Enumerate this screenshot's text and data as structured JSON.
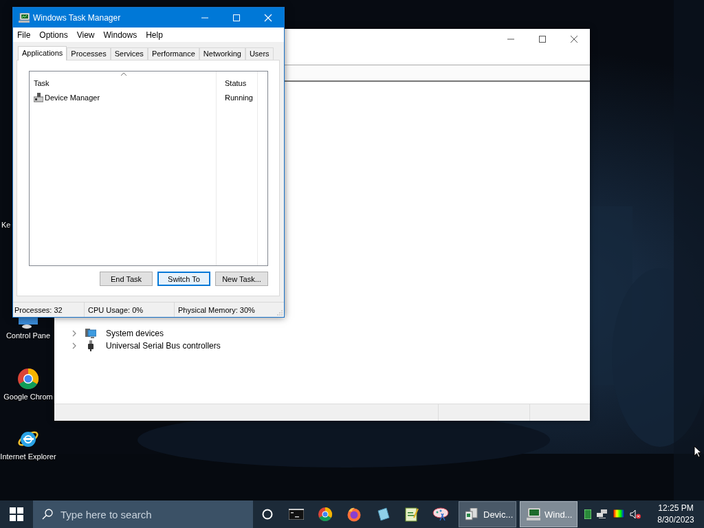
{
  "desktop_icons": [
    {
      "label": "Ke",
      "kind": "cut"
    },
    {
      "label": "Control Pane",
      "kind": "control"
    },
    {
      "label": "Google Chrom",
      "kind": "chrome"
    },
    {
      "label": "Internet Explorer",
      "kind": "ie"
    }
  ],
  "device_manager": {
    "tree": [
      {
        "label": "System devices",
        "kind": "system"
      },
      {
        "label": "Universal Serial Bus controllers",
        "kind": "usb"
      }
    ]
  },
  "task_manager": {
    "title": "Windows Task Manager",
    "menu": [
      "File",
      "Options",
      "View",
      "Windows",
      "Help"
    ],
    "tabs": [
      {
        "label": "Applications",
        "selected": true
      },
      {
        "label": "Processes",
        "selected": false
      },
      {
        "label": "Services",
        "selected": false
      },
      {
        "label": "Performance",
        "selected": false
      },
      {
        "label": "Networking",
        "selected": false
      },
      {
        "label": "Users",
        "selected": false
      }
    ],
    "columns": [
      "Task",
      "Status"
    ],
    "rows": [
      {
        "task": "Device Manager",
        "status": "Running"
      }
    ],
    "buttons": [
      {
        "label": "End Task",
        "focused": false
      },
      {
        "label": "Switch To",
        "focused": true
      },
      {
        "label": "New Task...",
        "focused": false
      }
    ],
    "status_bar": [
      "Processes: 32",
      "CPU Usage: 0%",
      "Physical Memory: 30%"
    ]
  },
  "taskbar": {
    "search": {
      "placeholder": "Type here to search"
    },
    "tasks": [
      {
        "label": "Devic...",
        "selected": false
      },
      {
        "label": "Wind...",
        "selected": true
      }
    ],
    "clock": {
      "time": "12:25 PM",
      "date": "8/30/2023"
    }
  }
}
